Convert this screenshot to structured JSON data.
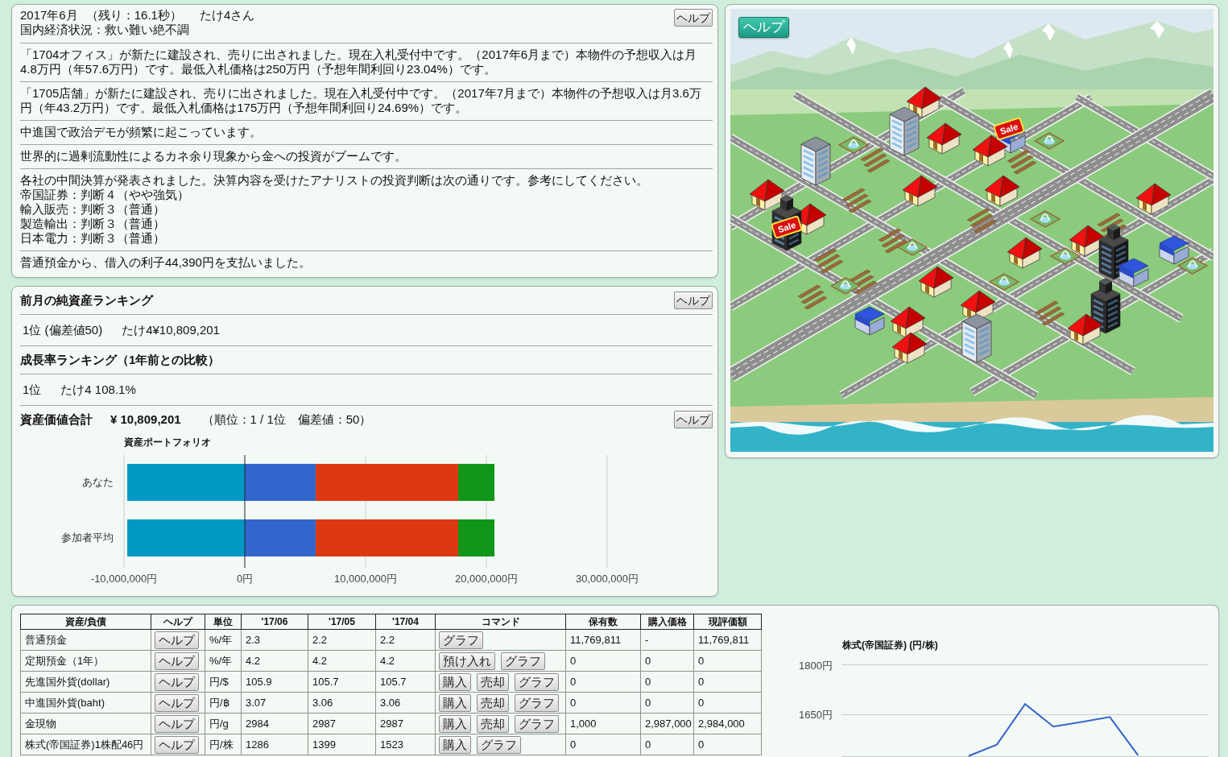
{
  "status": {
    "date": "2017年6月",
    "remaining": "（残り：16.1秒）",
    "player": "たけ4さん",
    "economy": "国内経済状況：救い難い絶不調",
    "help_button": "ヘルプ"
  },
  "news": [
    {
      "text": "「1704オフィス」が新たに建設され、売りに出されました。現在入札受付中です。（2017年6月まで）本物件の予想収入は月4.8万円（年57.6万円）です。最低入札価格は250万円（予想年間利回り23.04%）です。"
    },
    {
      "text": "「1705店舗」が新たに建設され、売りに出されました。現在入札受付中です。（2017年7月まで）本物件の予想収入は月3.6万円（年43.2万円）です。最低入札価格は175万円（予想年間利回り24.69%）です。"
    },
    {
      "text": "中進国で政治デモが頻繁に起こっています。"
    },
    {
      "text": "世界的に過剰流動性によるカネ余り現象から金への投資がブームです。"
    },
    {
      "text": "各社の中間決算が発表されました。決算内容を受けたアナリストの投資判断は次の通りです。参考にしてください。",
      "details": [
        "帝国証券：判断４（やや強気）",
        "輸入販売：判断３（普通）",
        "製造輸出：判断３（普通）",
        "日本電力：判断３（普通）"
      ]
    },
    {
      "text": "普通預金から、借入の利子44,390円を支払いました。"
    }
  ],
  "ranking": {
    "title": "前月の純資産ランキング",
    "help_button": "ヘルプ",
    "rows": [
      {
        "rank": "1位 (偏差値50)",
        "entry": "たけ4¥10,809,201"
      }
    ]
  },
  "growth_ranking": {
    "title": "成長率ランキング（1年前との比較）",
    "rows": [
      {
        "rank": "1位",
        "entry": "たけ4 108.1%"
      }
    ]
  },
  "assets": {
    "label": "資産価値合計",
    "total": "¥ 10,809,201",
    "rank_note": "（順位：1 / 1位　偏差値：50）",
    "help_button": "ヘルプ",
    "chart_data": {
      "type": "bar",
      "orientation": "horizontal",
      "stacked": true,
      "title": "資産ポートフォリオ",
      "categories": [
        "あなた",
        "参加者平均"
      ],
      "series": [
        {
          "color": "#0099c6",
          "values": [
            -9730000,
            -9730000
          ]
        },
        {
          "color": "#3366cc",
          "values": [
            5870000,
            5870000
          ]
        },
        {
          "color": "#dc3912",
          "values": [
            11800000,
            11800000
          ]
        },
        {
          "color": "#109618",
          "values": [
            3000000,
            3000000
          ]
        }
      ],
      "xlim": [
        -10000000,
        30000000
      ],
      "xticks": [
        {
          "value": -10000000,
          "label": "-10,000,000円"
        },
        {
          "value": 0,
          "label": "0円"
        },
        {
          "value": 10000000,
          "label": "10,000,000円"
        },
        {
          "value": 20000000,
          "label": "20,000,000円"
        },
        {
          "value": 30000000,
          "label": "30,000,000円"
        }
      ]
    }
  },
  "map": {
    "help_button": "ヘルプ",
    "signs": [
      "Sale",
      "Sale"
    ]
  },
  "holdings": {
    "columns": [
      "資産/負債",
      "ヘルプ",
      "単位",
      "'17/06",
      "'17/05",
      "'17/04",
      "コマンド",
      "保有数",
      "購入価格",
      "現評価額"
    ],
    "rows": [
      {
        "name": "普通預金",
        "help_button": "ヘルプ",
        "unit": "%/年",
        "history": [
          "2.3",
          "2.2",
          "2.2"
        ],
        "commands": [
          "グラフ"
        ],
        "quantity": "11,769,811",
        "purchase_price": "-",
        "valuation": "11,769,811"
      },
      {
        "name": "定期預金（1年）",
        "help_button": "ヘルプ",
        "unit": "%/年",
        "history": [
          "4.2",
          "4.2",
          "4.2"
        ],
        "commands": [
          "預け入れ",
          "グラフ"
        ],
        "quantity": "0",
        "purchase_price": "0",
        "valuation": "0"
      },
      {
        "name": "先進国外貨(dollar)",
        "help_button": "ヘルプ",
        "unit": "円/$",
        "history": [
          "105.9",
          "105.7",
          "105.7"
        ],
        "commands": [
          "購入",
          "売却",
          "グラフ"
        ],
        "quantity": "0",
        "purchase_price": "0",
        "valuation": "0"
      },
      {
        "name": "中進国外貨(baht)",
        "help_button": "ヘルプ",
        "unit": "円/฿",
        "history": [
          "3.07",
          "3.06",
          "3.06"
        ],
        "commands": [
          "購入",
          "売却",
          "グラフ"
        ],
        "quantity": "0",
        "purchase_price": "0",
        "valuation": "0"
      },
      {
        "name": "金現物",
        "help_button": "ヘルプ",
        "unit": "円/g",
        "history": [
          "2984",
          "2987",
          "2987"
        ],
        "commands": [
          "購入",
          "売却",
          "グラフ"
        ],
        "quantity": "1,000",
        "purchase_price": "2,987,000",
        "valuation": "2,984,000"
      },
      {
        "name": "株式(帝国証券)1株配46円",
        "help_button": "ヘルプ",
        "unit": "円/株",
        "history": [
          "1286",
          "1399",
          "1523"
        ],
        "commands": [
          "購入",
          "グラフ"
        ],
        "quantity": "0",
        "purchase_price": "0",
        "valuation": "0"
      }
    ],
    "chart_data": {
      "type": "line",
      "title": "株式(帝国証券) (円/株)",
      "categories": [
        null,
        null,
        null,
        null,
        null,
        null,
        null,
        null,
        null,
        null,
        null,
        null,
        null
      ],
      "ylim": [
        1524,
        1800
      ],
      "yticks": [
        {
          "value": 1800,
          "label": "1800円"
        },
        {
          "value": 1650,
          "label": "1650円"
        }
      ],
      "series": [
        {
          "color": "#3366cc",
          "values": [
            null,
            null,
            null,
            null,
            1526,
            1560,
            1682,
            1614,
            1628,
            1643,
            1528,
            null,
            null
          ]
        }
      ]
    }
  }
}
